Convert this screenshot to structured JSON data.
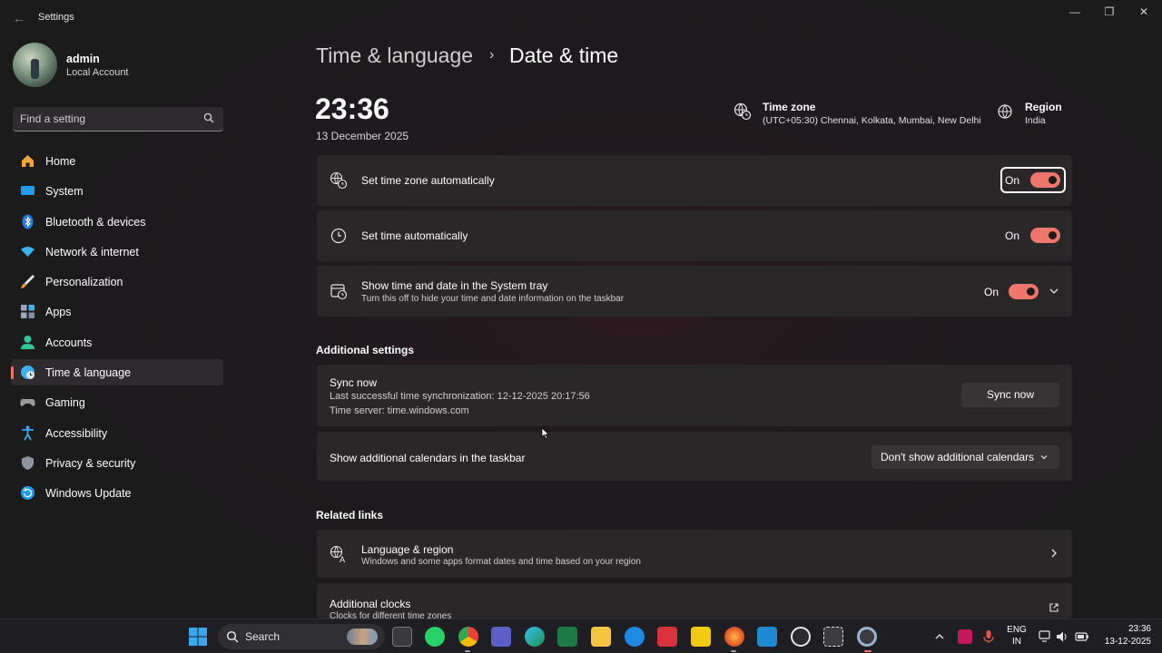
{
  "window": {
    "title": "Settings",
    "controls": {
      "minimize": "—",
      "restore": "❐",
      "close": "✕"
    }
  },
  "profile": {
    "name": "admin",
    "account_type": "Local Account"
  },
  "search": {
    "placeholder": "Find a setting"
  },
  "sidebar": {
    "items": [
      {
        "label": "Home",
        "icon": "home-icon",
        "color": "#f2a33a"
      },
      {
        "label": "System",
        "icon": "system-icon",
        "color": "#1e9bf0"
      },
      {
        "label": "Bluetooth & devices",
        "icon": "bluetooth-icon",
        "color": "#1e7bf0"
      },
      {
        "label": "Network & internet",
        "icon": "wifi-icon",
        "color": "#3ab1f0"
      },
      {
        "label": "Personalization",
        "icon": "brush-icon",
        "color": "#e8913a"
      },
      {
        "label": "Apps",
        "icon": "apps-icon",
        "color": "#7a8fa6"
      },
      {
        "label": "Accounts",
        "icon": "accounts-icon",
        "color": "#2fc69a"
      },
      {
        "label": "Time & language",
        "icon": "globe-clock-icon",
        "color": "#3ab1f0",
        "active": true
      },
      {
        "label": "Gaming",
        "icon": "gamepad-icon",
        "color": "#9a9a9a"
      },
      {
        "label": "Accessibility",
        "icon": "accessibility-icon",
        "color": "#3aa7f0"
      },
      {
        "label": "Privacy & security",
        "icon": "shield-icon",
        "color": "#8d96a0"
      },
      {
        "label": "Windows Update",
        "icon": "update-icon",
        "color": "#1e9bf0"
      }
    ]
  },
  "breadcrumb": {
    "parent": "Time & language",
    "separator": "›",
    "current": "Date & time"
  },
  "clock": {
    "time": "23:36",
    "date": "13 December 2025"
  },
  "timezone": {
    "title": "Time zone",
    "value": "(UTC+05:30) Chennai, Kolkata, Mumbai, New Delhi"
  },
  "region": {
    "title": "Region",
    "value": "India"
  },
  "settings": {
    "tz_auto": {
      "title": "Set time zone automatically",
      "state": "On"
    },
    "time_auto": {
      "title": "Set time automatically",
      "state": "On"
    },
    "tray": {
      "title": "Show time and date in the System tray",
      "subtitle": "Turn this off to hide your time and date information on the taskbar",
      "state": "On"
    }
  },
  "additional": {
    "heading": "Additional settings",
    "sync": {
      "title": "Sync now",
      "last": "Last successful time synchronization: 12-12-2025 20:17:56",
      "server": "Time server: time.windows.com",
      "button": "Sync now"
    },
    "calendars": {
      "title": "Show additional calendars in the taskbar",
      "selected": "Don't show additional calendars"
    }
  },
  "related": {
    "heading": "Related links",
    "language": {
      "title": "Language & region",
      "subtitle": "Windows and some apps format dates and time based on your region"
    },
    "clocks": {
      "title": "Additional clocks",
      "subtitle": "Clocks for different time zones"
    }
  },
  "taskbar": {
    "search_label": "Search",
    "lang_top": "ENG",
    "lang_bottom": "IN",
    "time": "23:36",
    "date": "13-12-2025"
  },
  "colors": {
    "accent": "#f0756b",
    "card": "#2a2729",
    "background": "#1b1b1c"
  }
}
